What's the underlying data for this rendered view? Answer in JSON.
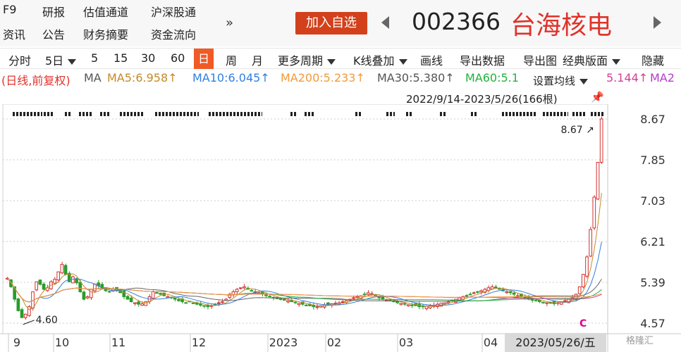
{
  "header": {
    "nav": [
      "F9",
      "研报",
      "估值通道",
      "沪深股通",
      "资讯",
      "公告",
      "财务摘要",
      "资金流向"
    ],
    "more_label": "»",
    "add_watch": "加入自选",
    "code": "002366",
    "name": "台海核电"
  },
  "toolbar": {
    "items": [
      "分时",
      "5日",
      "5",
      "15",
      "30",
      "60",
      "日",
      "周",
      "月",
      "更多周期",
      "K线叠加",
      "画线",
      "导出数据",
      "导出图",
      "经典版面",
      "隐藏"
    ],
    "active": "日"
  },
  "ma_legend": {
    "mode": "(日线,前复权)",
    "ma": "MA",
    "ma5": "MA5:6.958↑",
    "ma10": "MA10:6.045↑",
    "ma200": "MA200:5.233↑",
    "ma30": "MA30:5.380↑",
    "ma60": "MA60:5.1",
    "ma120_tail": "5.144↑",
    "ma250_head": "MA2",
    "colors": {
      "mode": "#e0322a",
      "ma": "#555555",
      "ma5": "#c48a2a",
      "ma10": "#2f7fe0",
      "ma200": "#f29a3a",
      "ma30": "#555555",
      "ma60": "#22b13c",
      "ma120": "#d0409a",
      "ma250": "#b43cc8"
    }
  },
  "avg_setting": "设置均线",
  "range_info": "2022/9/14-2023/5/26(166根)",
  "price_labels": [
    "8.67",
    "7.85",
    "7.03",
    "6.21",
    "5.39",
    "4.57"
  ],
  "x_labels": [
    "9",
    "10",
    "11",
    "12",
    "2023",
    "02",
    "03",
    "04"
  ],
  "date_badge": "2023/05/26/五",
  "high_annotation": "8.67",
  "low_annotation": "4.60",
  "c_mark": "C",
  "watermark": "格隆汇",
  "chart_data": {
    "type": "candlestick",
    "period": "2022/9/14-2023/5/26",
    "bars": 166,
    "ylim": [
      4.57,
      8.67
    ],
    "y_ticks": [
      8.67,
      7.85,
      7.03,
      6.21,
      5.39,
      4.57
    ],
    "high": 8.67,
    "low": 4.6,
    "up_color": "#2a9c2a",
    "down_color": "#d23030",
    "close_path": [
      5.47,
      5.3,
      5.05,
      4.82,
      4.68,
      4.75,
      4.9,
      5.2,
      5.4,
      5.35,
      5.25,
      5.28,
      5.4,
      5.45,
      5.6,
      5.75,
      5.55,
      5.4,
      5.5,
      5.38,
      5.2,
      5.05,
      5.1,
      5.25,
      5.35,
      5.32,
      5.28,
      5.22,
      5.2,
      5.25,
      5.22,
      5.18,
      5.1,
      5.05,
      5.0,
      4.98,
      4.95,
      4.96,
      5.0,
      5.1,
      5.2,
      5.18,
      5.15,
      5.12,
      5.1,
      5.08,
      5.05,
      5.02,
      5.0,
      4.98,
      5.0,
      4.97,
      4.95,
      4.93,
      4.92,
      4.9,
      4.92,
      4.95,
      4.98,
      5.0,
      5.05,
      5.15,
      5.2,
      5.25,
      5.28,
      5.3,
      5.25,
      5.22,
      5.2,
      5.18,
      5.15,
      5.12,
      5.1,
      5.08,
      5.06,
      5.05,
      5.03,
      5.02,
      5.0,
      4.98,
      4.97,
      4.95,
      4.93,
      4.92,
      4.9,
      4.9,
      4.92,
      4.94,
      4.95,
      4.96,
      4.97,
      4.98,
      5.0,
      5.02,
      5.05,
      5.08,
      5.1,
      5.12,
      5.15,
      5.18,
      5.16,
      5.12,
      5.08,
      5.05,
      5.03,
      5.02,
      5.0,
      4.98,
      4.97,
      4.95,
      4.94,
      4.93,
      4.92,
      4.9,
      4.9,
      4.91,
      4.92,
      4.93,
      4.95,
      4.97,
      4.98,
      5.0,
      5.02,
      5.05,
      5.08,
      5.1,
      5.12,
      5.15,
      5.18,
      5.2,
      5.22,
      5.25,
      5.28,
      5.3,
      5.28,
      5.25,
      5.22,
      5.2,
      5.18,
      5.15,
      5.12,
      5.1,
      5.08,
      5.05,
      5.03,
      5.02,
      5.0,
      4.99,
      4.98,
      4.97,
      4.96,
      4.98,
      5.0,
      5.02,
      5.05,
      5.08,
      5.15,
      5.3,
      5.55,
      5.9,
      6.45,
      7.1,
      7.8,
      8.67
    ]
  }
}
